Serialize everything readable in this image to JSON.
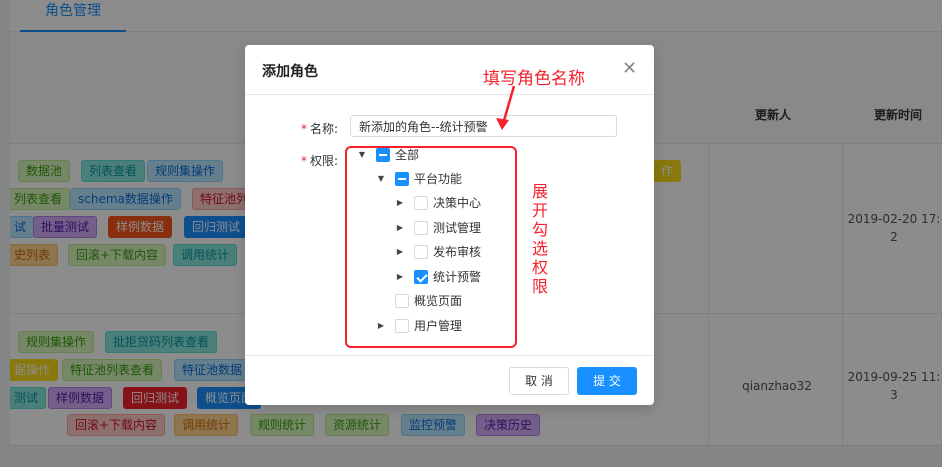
{
  "page": {
    "tab_active": "角色管理",
    "columns": {
      "updated_by": "更新人",
      "updated_at": "更新时间"
    },
    "rows": [
      {
        "updated_by": "",
        "updated_at": "2019-02-20 17:\n2",
        "tags": [
          {
            "label": "数据池",
            "color": "t-green"
          },
          {
            "label": "列表查看",
            "color": "t-cyan"
          },
          {
            "label": "规则集操作",
            "color": "t-blue"
          },
          {
            "label": "列表查看",
            "color": "t-green"
          },
          {
            "label": "schema数据操作",
            "color": "t-blue"
          },
          {
            "label": "特征池列",
            "color": "t-red"
          },
          {
            "label": "试",
            "color": "t-blue"
          },
          {
            "label": "批量测试",
            "color": "t-purple"
          },
          {
            "label": "样例数据",
            "color": "t-darkorange"
          },
          {
            "label": "回归测试",
            "color": "t-darkblue"
          },
          {
            "label": "史列表",
            "color": "t-orange"
          },
          {
            "label": "回滚+下载内容",
            "color": "t-green"
          },
          {
            "label": "调用统计",
            "color": "t-cyan"
          }
        ]
      },
      {
        "updated_by": "qianzhao32",
        "updated_at": "2019-09-25 11:\n3",
        "tags": [
          {
            "label": "规则集操作",
            "color": "t-green"
          },
          {
            "label": "批拒贷码列表查看",
            "color": "t-cyan"
          },
          {
            "label": "据操作",
            "color": "t-gold"
          },
          {
            "label": "特征池列表查看",
            "color": "t-green"
          },
          {
            "label": "特征池数据",
            "color": "t-blue"
          },
          {
            "label": "测试",
            "color": "t-cyan"
          },
          {
            "label": "样例数据",
            "color": "t-purple"
          },
          {
            "label": "回归测试",
            "color": "t-darkred"
          },
          {
            "label": "概览页面",
            "color": "t-darkblue"
          },
          {
            "label": "回滚+下载内容",
            "color": "t-red"
          },
          {
            "label": "调用统计",
            "color": "t-orange"
          },
          {
            "label": "规则统计",
            "color": "t-green"
          },
          {
            "label": "资源统计",
            "color": "t-green"
          },
          {
            "label": "监控预警",
            "color": "t-blue"
          },
          {
            "label": "决策历史",
            "color": "t-purple"
          }
        ]
      }
    ],
    "right_tags_row1": [
      {
        "label": "作",
        "color": "t-gold"
      }
    ]
  },
  "modal": {
    "title": "添加角色",
    "close_icon": "close-icon",
    "name_label": "名称:",
    "name_value": "新添加的角色--统计预警",
    "permission_label": "权限:",
    "required_mark": "*",
    "tree": {
      "all": "全部",
      "platform": "平台功能",
      "decision_center": "决策中心",
      "test_management": "测试管理",
      "release_review": "发布审核",
      "stats_alert": "统计预警",
      "overview_page": "概览页面",
      "user_management": "用户管理"
    },
    "cancel_label": "取 消",
    "submit_label": "提 交"
  },
  "annotations": {
    "fill_name": "填写角色名称",
    "expand_check": "展开勾选权限"
  },
  "colors": {
    "primary": "#1890ff",
    "annotation": "#f5222d"
  }
}
